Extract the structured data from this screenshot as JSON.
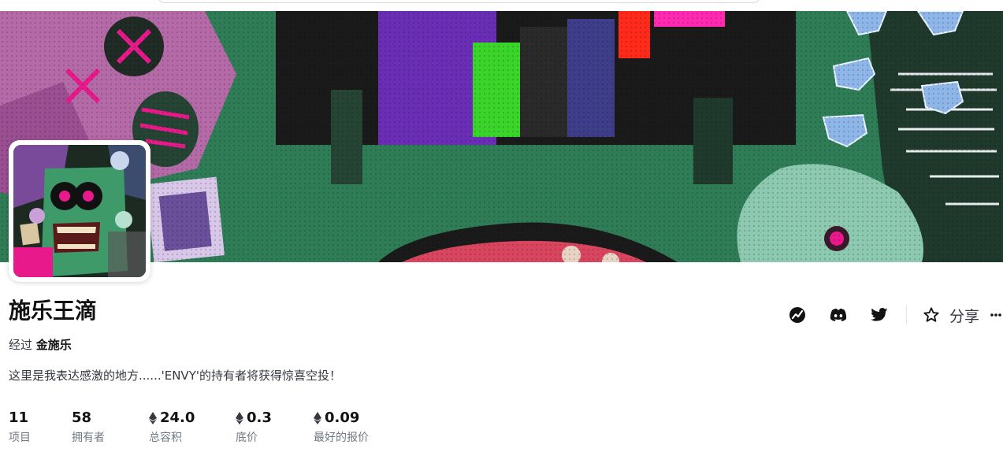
{
  "collection": {
    "name": "施乐王滴",
    "by_prefix": "经过",
    "creator": "金施乐",
    "description": "这里是我表达感激的地方......'ENVY'的持有者将获得惊喜空投！"
  },
  "stats": [
    {
      "value": "11",
      "label": "项目",
      "eth": false
    },
    {
      "value": "58",
      "label": "拥有者",
      "eth": false
    },
    {
      "value": "24.0",
      "label": "总容积",
      "eth": true
    },
    {
      "value": "0.3",
      "label": "底价",
      "eth": true
    },
    {
      "value": "0.09",
      "label": "最好的报价",
      "eth": true
    }
  ],
  "actions": {
    "icons": [
      "analytics-icon",
      "discord-icon",
      "twitter-icon"
    ],
    "share_label": "分享"
  },
  "colors": {
    "banner_green": "#2f7d57",
    "accent_pink": "#e8198b",
    "accent_purple": "#6a2db5",
    "text_dark": "#121212",
    "text_muted": "#707a83"
  }
}
